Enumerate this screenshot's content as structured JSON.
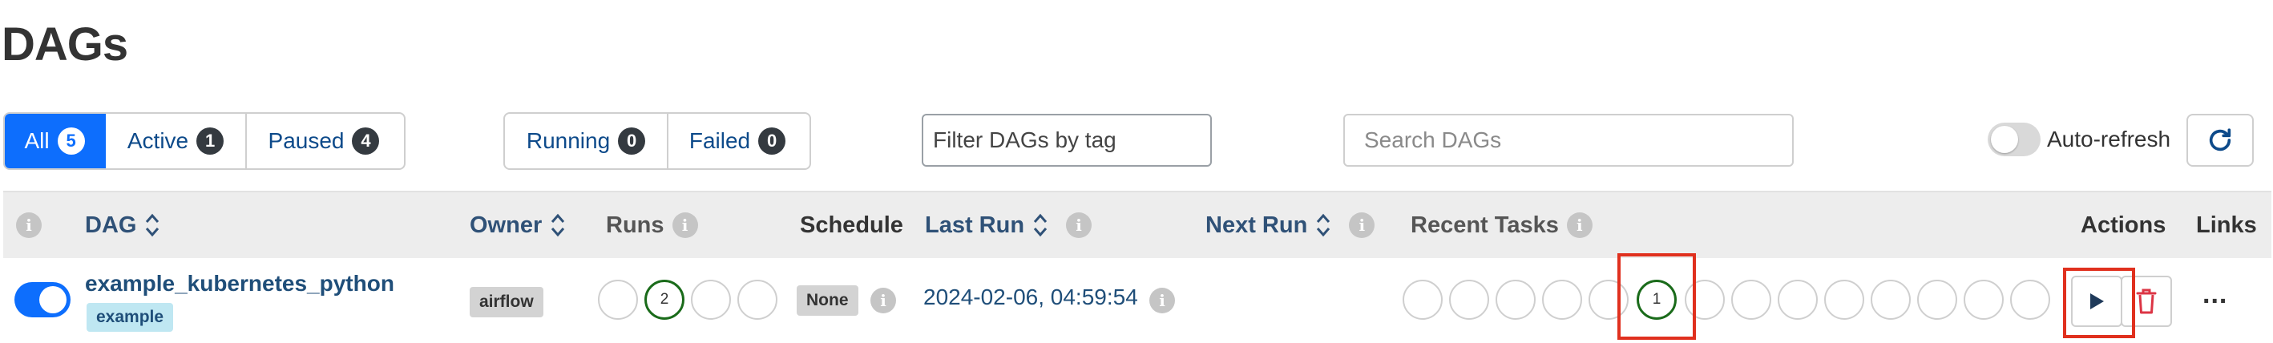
{
  "page": {
    "title": "DAGs"
  },
  "status_filters": [
    {
      "label": "All",
      "count": "5",
      "active": true
    },
    {
      "label": "Active",
      "count": "1",
      "active": false
    },
    {
      "label": "Paused",
      "count": "4",
      "active": false
    }
  ],
  "run_filters": [
    {
      "label": "Running",
      "count": "0"
    },
    {
      "label": "Failed",
      "count": "0"
    }
  ],
  "tag_filter": {
    "placeholder": "Filter DAGs by tag"
  },
  "search": {
    "placeholder": "Search DAGs"
  },
  "auto_refresh": {
    "label": "Auto-refresh",
    "enabled": false
  },
  "table": {
    "headers": {
      "dag": "DAG",
      "owner": "Owner",
      "runs": "Runs",
      "schedule": "Schedule",
      "last_run": "Last Run",
      "next_run": "Next Run",
      "recent_tasks": "Recent Tasks",
      "actions": "Actions",
      "links": "Links"
    },
    "rows": [
      {
        "paused": false,
        "dag_id": "example_kubernetes_python",
        "tag": "example",
        "owner": "airflow",
        "runs": [
          "",
          "2",
          "",
          ""
        ],
        "schedule": "None",
        "last_run": "2024-02-06, 04:59:54",
        "recent_tasks_highlight": "1",
        "more_label": "..."
      }
    ]
  },
  "colors": {
    "primary": "#0d6efd",
    "link": "#1f4e79",
    "success": "#1a6b1a",
    "highlight": "#e0301e",
    "delete": "#dc3545"
  },
  "icons": [
    "info-icon",
    "sort-icon",
    "refresh-icon",
    "play-icon",
    "trash-icon",
    "more-icon"
  ]
}
